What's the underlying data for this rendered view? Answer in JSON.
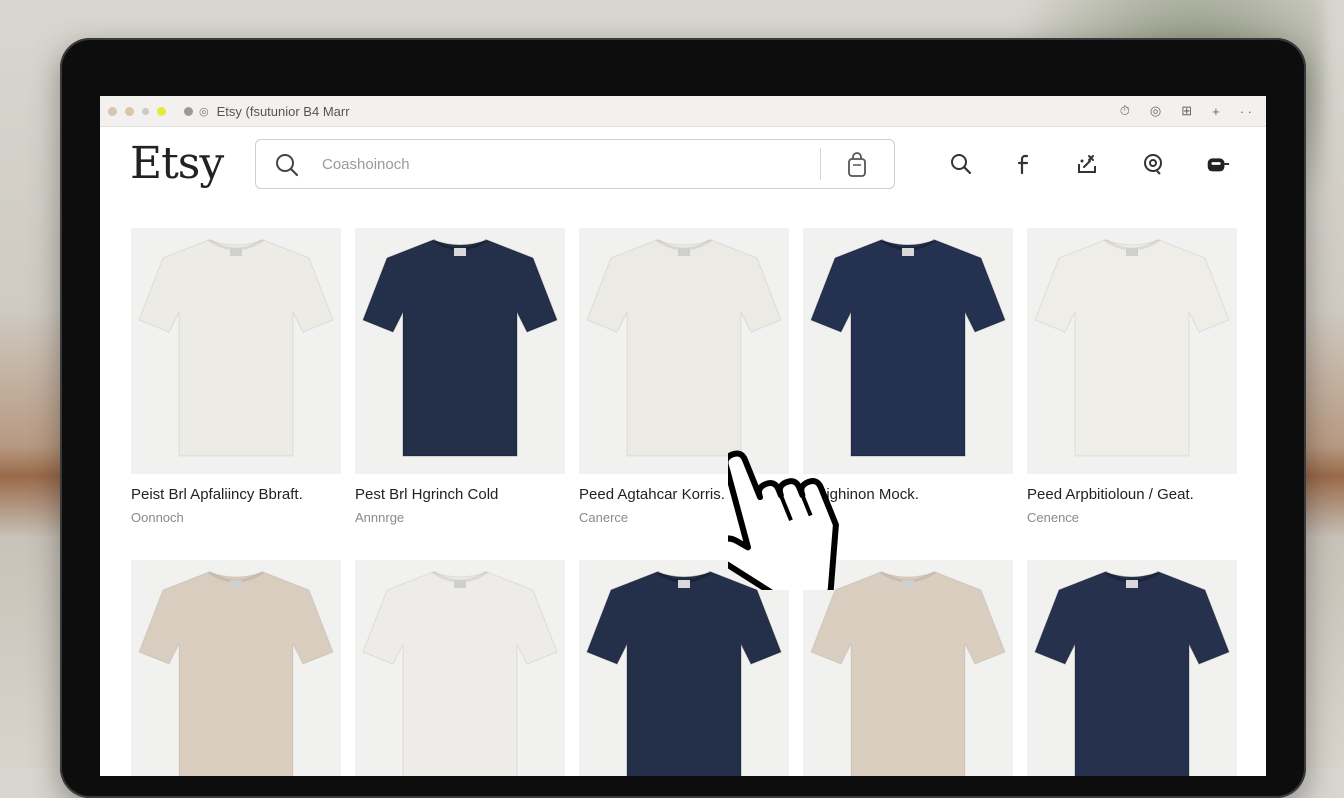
{
  "browser": {
    "title": "Etsy (fsutunior B4 Marr"
  },
  "header": {
    "logo": "Etsy",
    "search_placeholder": "Coashoinoch"
  },
  "products": [
    {
      "title": "Peist Brl Apfaliincy Bbraft.",
      "subtitle": "Oonnoch",
      "color": "#ecebe6"
    },
    {
      "title": "Pest Brl Hgrinch Cold",
      "subtitle": "Annnrge",
      "color": "#24304a"
    },
    {
      "title": "Peed Agtahcar Korris.",
      "subtitle": "Canerce",
      "color": "#ebeae5"
    },
    {
      "title": "rl Highinon Mock.",
      "subtitle": "",
      "color": "#253150"
    },
    {
      "title": "Peed Arpbitioloun / Geat.",
      "subtitle": "Cenence",
      "color": "#eeede8"
    },
    {
      "title": "",
      "subtitle": "",
      "color": "#d8cdbe"
    },
    {
      "title": "",
      "subtitle": "",
      "color": "#edece8"
    },
    {
      "title": "",
      "subtitle": "",
      "color": "#243049"
    },
    {
      "title": "",
      "subtitle": "",
      "color": "#d9cebf"
    },
    {
      "title": "",
      "subtitle": "",
      "color": "#26324d"
    }
  ]
}
